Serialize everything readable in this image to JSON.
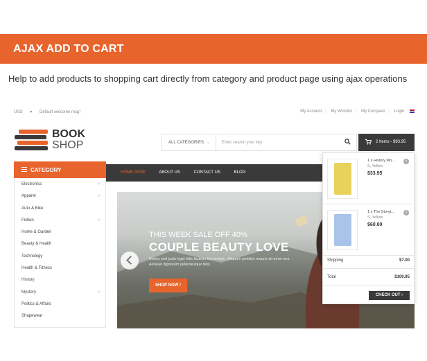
{
  "banner": {
    "title": "AJAX ADD TO CART"
  },
  "subtitle": "Help to add products to shopping cart directly from category and product page using ajax operations",
  "topbar": {
    "currency": "USD",
    "welcome": "Default welcome msg!",
    "links": [
      "My Account",
      "My Wishlist",
      "My Compare",
      "Login"
    ]
  },
  "logo": {
    "line1": "BOOK",
    "line2": "SHOP"
  },
  "search": {
    "category": "ALL CATEGORIES",
    "placeholder": "Enter search your key"
  },
  "cart": {
    "summary": "2 Items - $93.95"
  },
  "nav": {
    "category_title": "CATEGORY",
    "links": [
      "HOME PAGE",
      "ABOUT US",
      "CONTACT US",
      "BLOG"
    ]
  },
  "categories": [
    {
      "label": "Electronics",
      "arrow": true
    },
    {
      "label": "Apparel",
      "arrow": true
    },
    {
      "label": "Auto & Bike",
      "arrow": false
    },
    {
      "label": "Fiction",
      "arrow": true
    },
    {
      "label": "Home & Garden",
      "arrow": false
    },
    {
      "label": "Beauty & Health",
      "arrow": false
    },
    {
      "label": "Technology",
      "arrow": false
    },
    {
      "label": "Health & Fitness",
      "arrow": false
    },
    {
      "label": "History",
      "arrow": false
    },
    {
      "label": "Mystery",
      "arrow": true
    },
    {
      "label": "Politics & Affairs",
      "arrow": false
    },
    {
      "label": "Shapewear",
      "arrow": false
    }
  ],
  "hero": {
    "sale": "THIS WEEK SALE OFF 40%",
    "headline": "COUPLE BEAUTY LOVE",
    "description": "Donec sed justo eget felis facilisis fermentum. Aliquam porttitor mauris sit amet orci. Aenean dignissim pellentesque felis.",
    "button": "SHOP NOW !"
  },
  "dropdown": {
    "items": [
      {
        "qty": "1 x",
        "name": "History Mo...",
        "option": "S, Yellow",
        "price": "$33.95",
        "cover": "#e8d25a"
      },
      {
        "qty": "1 x",
        "name": "The Storyt...",
        "option": "S, Yellow",
        "price": "$60.00",
        "cover": "#a9c4e8"
      }
    ],
    "shipping_label": "Shipping",
    "shipping_value": "$7.00",
    "total_label": "Total",
    "total_value": "$100.95",
    "checkout": "CHECK OUT"
  },
  "colors": {
    "accent": "#e8642d",
    "dark": "#3a3a3a"
  }
}
